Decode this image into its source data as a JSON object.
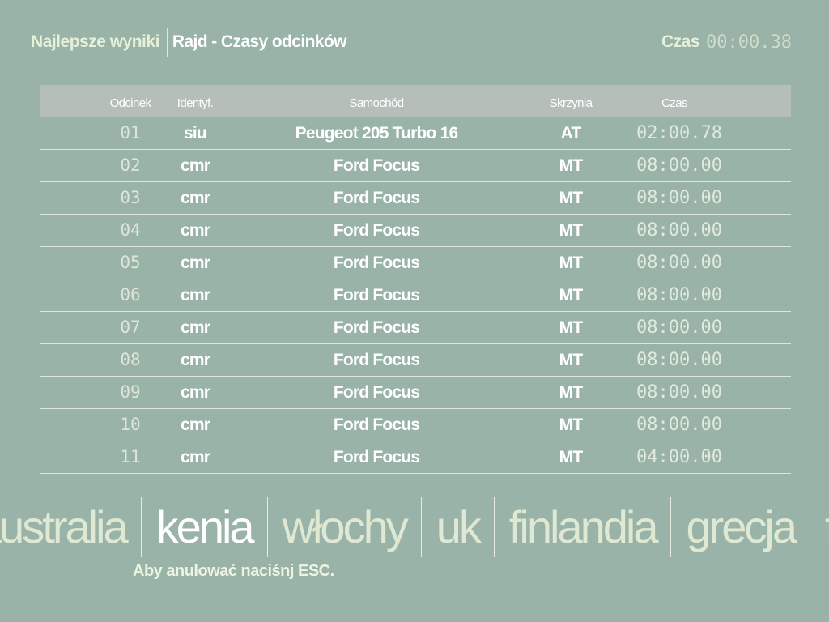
{
  "header": {
    "section": "Najlepsze wyniki",
    "title": "Rajd - Czasy odcinków",
    "time_label": "Czas",
    "time_value": "00:00.38"
  },
  "table": {
    "columns": [
      "Odcinek",
      "Identyf.",
      "Samochód",
      "Skrzynia",
      "Czas"
    ],
    "rows": [
      [
        "01",
        "siu",
        "Peugeot 205 Turbo 16",
        "AT",
        "02:00.78"
      ],
      [
        "02",
        "cmr",
        "Ford Focus",
        "MT",
        "08:00.00"
      ],
      [
        "03",
        "cmr",
        "Ford Focus",
        "MT",
        "08:00.00"
      ],
      [
        "04",
        "cmr",
        "Ford Focus",
        "MT",
        "08:00.00"
      ],
      [
        "05",
        "cmr",
        "Ford Focus",
        "MT",
        "08:00.00"
      ],
      [
        "06",
        "cmr",
        "Ford Focus",
        "MT",
        "08:00.00"
      ],
      [
        "07",
        "cmr",
        "Ford Focus",
        "MT",
        "08:00.00"
      ],
      [
        "08",
        "cmr",
        "Ford Focus",
        "MT",
        "08:00.00"
      ],
      [
        "09",
        "cmr",
        "Ford Focus",
        "MT",
        "08:00.00"
      ],
      [
        "10",
        "cmr",
        "Ford Focus",
        "MT",
        "08:00.00"
      ],
      [
        "11",
        "cmr",
        "Ford Focus",
        "MT",
        "04:00.00"
      ]
    ]
  },
  "countries": {
    "items": [
      "australia",
      "kenia",
      "włochy",
      "uk",
      "finlandia",
      "grecja",
      "f"
    ],
    "selected": "kenia"
  },
  "footer": {
    "hint": "Aby anulować naciśnj ESC."
  }
}
